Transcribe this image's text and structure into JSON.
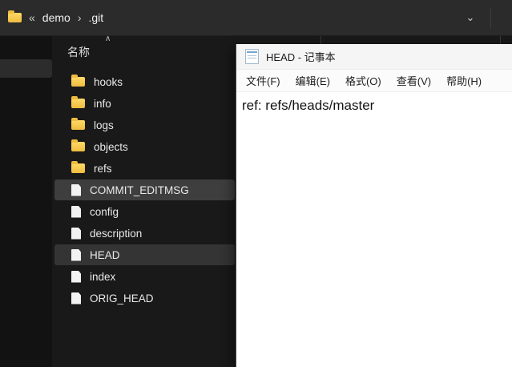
{
  "address_bar": {
    "back_chevrons": "«",
    "separator": "›",
    "crumbs": [
      {
        "label": "demo"
      },
      {
        "label": ".git"
      }
    ],
    "dropdown_icon": "⌄"
  },
  "explorer": {
    "name_column_header": "名称",
    "sort_indicator": "∧",
    "items": [
      {
        "name": "hooks",
        "type": "folder",
        "selected": false
      },
      {
        "name": "info",
        "type": "folder",
        "selected": false
      },
      {
        "name": "logs",
        "type": "folder",
        "selected": false
      },
      {
        "name": "objects",
        "type": "folder",
        "selected": false
      },
      {
        "name": "refs",
        "type": "folder",
        "selected": false
      },
      {
        "name": "COMMIT_EDITMSG",
        "type": "file",
        "selected": true
      },
      {
        "name": "config",
        "type": "file",
        "selected": false
      },
      {
        "name": "description",
        "type": "file",
        "selected": false
      },
      {
        "name": "HEAD",
        "type": "file",
        "selected": true
      },
      {
        "name": "index",
        "type": "file",
        "selected": false
      },
      {
        "name": "ORIG_HEAD",
        "type": "file",
        "selected": false
      }
    ]
  },
  "notepad": {
    "title": "HEAD - 记事本",
    "menu_items": [
      "文件(F)",
      "编辑(E)",
      "格式(O)",
      "查看(V)",
      "帮助(H)"
    ],
    "body_text": "ref: refs/heads/master"
  },
  "colors": {
    "folder_yellow": "#f2c64a",
    "selection_gray": "#3e3e3e",
    "dark_background": "#191919",
    "address_bar": "#2b2b2b"
  }
}
